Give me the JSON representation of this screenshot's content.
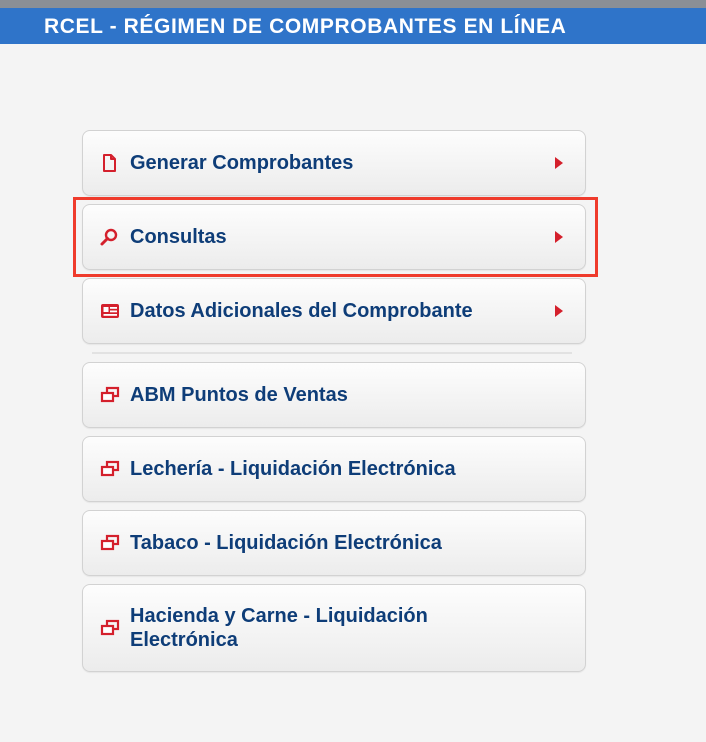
{
  "header": {
    "title": "RCEL - RÉGIMEN DE COMPROBANTES EN LÍNEA"
  },
  "menu": {
    "items": [
      {
        "label": "Generar Comprobantes",
        "icon": "document-icon",
        "has_arrow": true
      },
      {
        "label": "Consultas",
        "icon": "magnifier-icon",
        "has_arrow": true
      },
      {
        "label": "Datos Adicionales del Comprobante",
        "icon": "id-card-icon",
        "has_arrow": true
      },
      {
        "label": "ABM Puntos de Ventas",
        "icon": "external-window-icon",
        "has_arrow": false
      },
      {
        "label": "Lechería - Liquidación Electrónica",
        "icon": "external-window-icon",
        "has_arrow": false
      },
      {
        "label": "Tabaco - Liquidación Electrónica",
        "icon": "external-window-icon",
        "has_arrow": false
      },
      {
        "label": "Hacienda y Carne - Liquidación Electrónica",
        "icon": "external-window-icon",
        "has_arrow": false
      }
    ]
  },
  "colors": {
    "header_bg": "#2f74c9",
    "label_text": "#0e3d78",
    "icon_accent": "#d4202c",
    "highlight_border": "#ef3b2c"
  }
}
